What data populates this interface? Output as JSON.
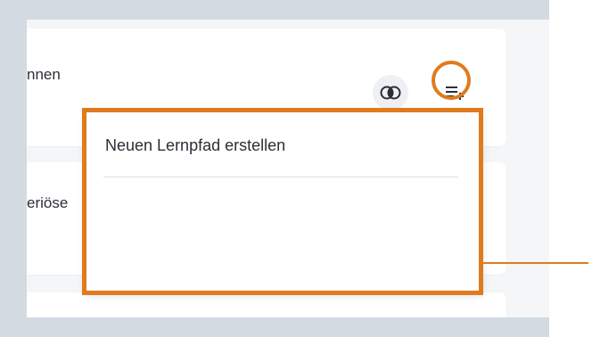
{
  "cards": [
    {
      "title": "nnen"
    },
    {
      "title": "eriöse"
    }
  ],
  "actions": {
    "compare_icon": "overlap-circles-icon",
    "add_to_list_icon": "playlist-add-icon"
  },
  "dropdown": {
    "items": [
      {
        "label": "Neuen Lernpfad erstellen"
      }
    ]
  },
  "colors": {
    "highlight": "#e07b1d",
    "frame": "#d3dae2",
    "text": "#2b2f36"
  }
}
